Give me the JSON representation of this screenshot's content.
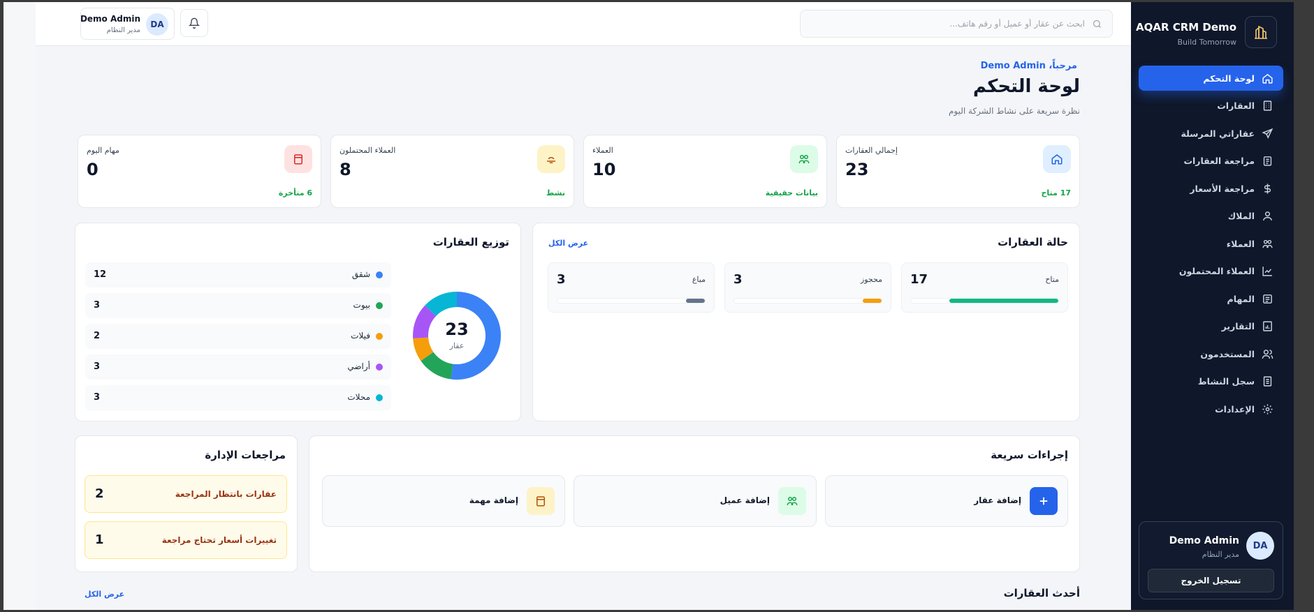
{
  "sidebar": {
    "brand_title": "AQAR CRM Demo",
    "brand_subtitle": "Build Tomorrow",
    "items": [
      {
        "label": "لوحة التحكم",
        "icon": "home-icon",
        "active": true
      },
      {
        "label": "العقارات",
        "icon": "building-icon"
      },
      {
        "label": "عقاراتي المرسلة",
        "icon": "send-icon"
      },
      {
        "label": "مراجعة العقارات",
        "icon": "clipboard-icon"
      },
      {
        "label": "مراجعة الأسعار",
        "icon": "dollar-icon"
      },
      {
        "label": "الملاك",
        "icon": "user-icon"
      },
      {
        "label": "العملاء",
        "icon": "users-icon"
      },
      {
        "label": "العملاء المحتملون",
        "icon": "trend-icon"
      },
      {
        "label": "المهام",
        "icon": "task-icon"
      },
      {
        "label": "التقارير",
        "icon": "report-icon"
      },
      {
        "label": "المستخدمون",
        "icon": "user-group-icon"
      },
      {
        "label": "سجل النشاط",
        "icon": "log-icon"
      },
      {
        "label": "الإعدادات",
        "icon": "gear-icon"
      }
    ],
    "user": {
      "initials": "DA",
      "name": "Demo Admin",
      "role": "مدير النظام",
      "logout": "تسجيل الخروج"
    }
  },
  "header": {
    "search_placeholder": "ابحث عن عقار أو عميل أو رقم هاتف...",
    "user": {
      "initials": "DA",
      "name": "Demo Admin",
      "role": "مدير النظام"
    }
  },
  "page": {
    "welcome": "مرحباً، Demo Admin",
    "title": "لوحة التحكم",
    "subtitle": "نظرة سريعة على نشاط الشركة اليوم"
  },
  "stats": [
    {
      "label": "إجمالي العقارات",
      "value": "23",
      "foot": "17 متاح",
      "icon": "home-icon",
      "icon_color": "#2563eb",
      "icon_bg": "#e0efff"
    },
    {
      "label": "العملاء",
      "value": "10",
      "foot": "بيانات حقيقية",
      "icon": "users-icon",
      "icon_color": "#16a34a",
      "icon_bg": "#dcfce7"
    },
    {
      "label": "العملاء المحتملون",
      "value": "8",
      "foot": "نشط",
      "icon": "lead-icon",
      "icon_color": "#b45309",
      "icon_bg": "#fef3c7"
    },
    {
      "label": "مهام اليوم",
      "value": "0",
      "foot": "6 متأخرة",
      "icon": "calendar-icon",
      "icon_color": "#dc2626",
      "icon_bg": "#fee2e2"
    }
  ],
  "status_panel": {
    "title": "حالة العقارات",
    "view_all": "عرض الكل",
    "items": [
      {
        "label": "متاح",
        "value": "17",
        "fraction": 0.74,
        "color": "#10b981"
      },
      {
        "label": "محجوز",
        "value": "3",
        "fraction": 0.13,
        "color": "#f59e0b"
      },
      {
        "label": "مباع",
        "value": "3",
        "fraction": 0.13,
        "color": "#64748b"
      }
    ]
  },
  "distribution": {
    "title": "توزيع العقارات",
    "total": "23",
    "total_label": "عقار",
    "items": [
      {
        "label": "شقق",
        "count": "12",
        "value": 12,
        "color": "#3b82f6"
      },
      {
        "label": "بيوت",
        "count": "3",
        "value": 3,
        "color": "#22a559"
      },
      {
        "label": "فيلات",
        "count": "2",
        "value": 2,
        "color": "#f59e0b"
      },
      {
        "label": "أراضي",
        "count": "3",
        "value": 3,
        "color": "#a855f7"
      },
      {
        "label": "محلات",
        "count": "3",
        "value": 3,
        "color": "#06b6d4"
      }
    ]
  },
  "quick_actions": {
    "title": "إجراءات سريعة",
    "items": [
      {
        "label": "إضافة عقار",
        "icon": "plus-icon",
        "icon_color": "#ffffff",
        "icon_bg": "#2563eb"
      },
      {
        "label": "إضافة عميل",
        "icon": "users-icon",
        "icon_color": "#16a34a",
        "icon_bg": "#dcfce7"
      },
      {
        "label": "إضافة مهمة",
        "icon": "calendar-icon",
        "icon_color": "#b45309",
        "icon_bg": "#fef3c7"
      }
    ]
  },
  "admin_reviews": {
    "title": "مراجعات الإدارة",
    "items": [
      {
        "label": "عقارات بانتظار المراجعة",
        "count": "2"
      },
      {
        "label": "تغييرات أسعار تحتاج مراجعة",
        "count": "1"
      }
    ]
  },
  "recent": {
    "title": "أحدث العقارات",
    "view_all": "عرض الكل"
  }
}
